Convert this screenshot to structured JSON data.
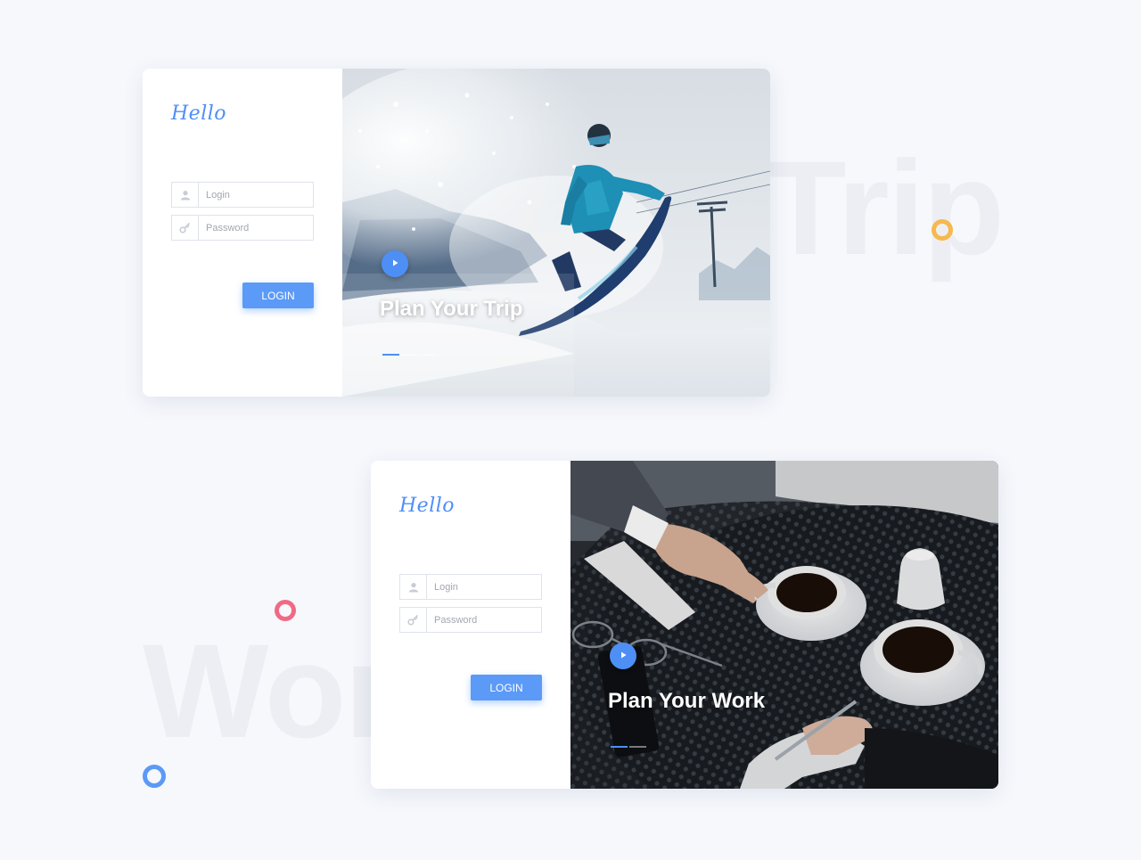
{
  "background_words": [
    "Trip",
    "Work"
  ],
  "colors": {
    "accent": "#4e8ff5",
    "button": "#5b9af6",
    "ring_blue": "#5b9af6",
    "ring_orange": "#f7b84e",
    "ring_pink": "#f06a85",
    "background": "#f6f8fc"
  },
  "cards": [
    {
      "greeting": "Hello",
      "login_placeholder": "Login",
      "password_placeholder": "Password",
      "login_icon": "user-icon",
      "password_icon": "key-icon",
      "button_label": "LOGIN",
      "photo_title": "Plan Your Trip",
      "photo_subject": "snowboarder",
      "play_icon": "play-icon",
      "slides": 3,
      "active_slide": 1
    },
    {
      "greeting": "Hello",
      "login_placeholder": "Login",
      "password_placeholder": "Password",
      "login_icon": "user-icon",
      "password_icon": "key-icon",
      "button_label": "LOGIN",
      "photo_title": "Plan Your Work",
      "photo_subject": "coffee-table",
      "play_icon": "play-icon",
      "slides": 2,
      "active_slide": 1
    }
  ]
}
